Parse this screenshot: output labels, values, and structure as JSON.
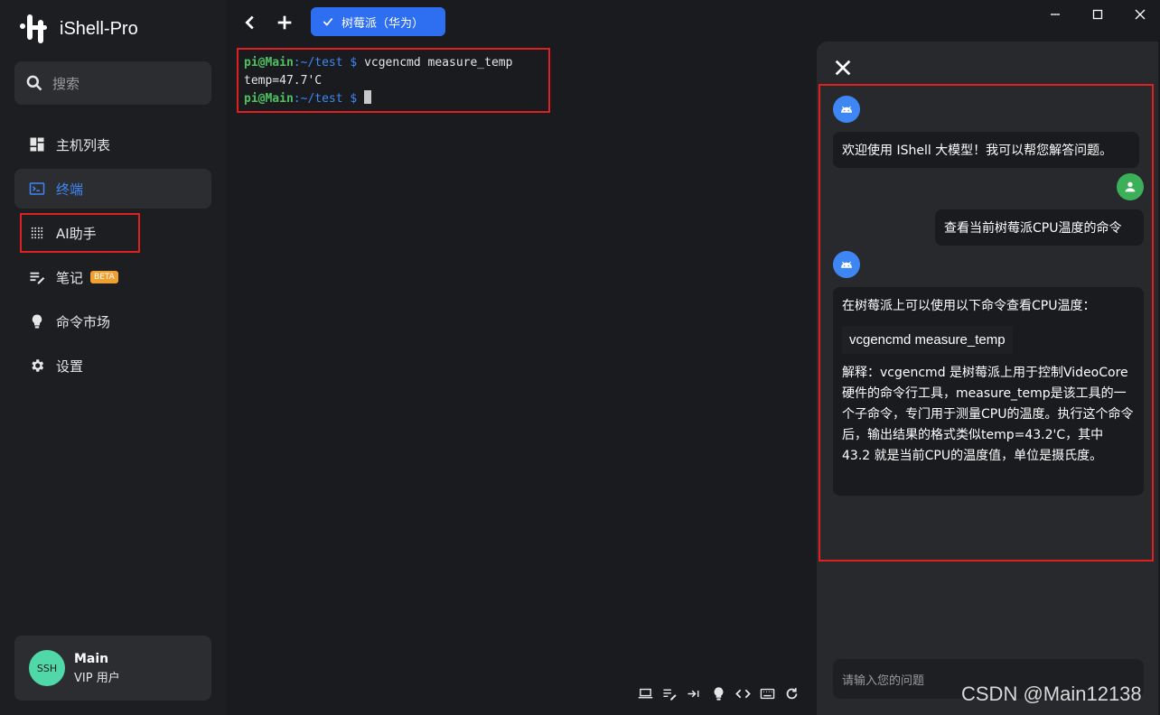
{
  "app": {
    "name": "iShell-Pro"
  },
  "search": {
    "placeholder": "搜索"
  },
  "nav": {
    "hosts": "主机列表",
    "terminal": "终端",
    "ai": "AI助手",
    "notes": "笔记",
    "notes_badge": "BETA",
    "market": "命令市场",
    "settings": "设置"
  },
  "profile": {
    "avatar_text": "SSH",
    "name": "Main",
    "role": "VIP 用户"
  },
  "tab": {
    "label": "树莓派（华为）"
  },
  "terminal": {
    "lines": [
      {
        "user": "pi@Main",
        "path": ":~/test $",
        "cmd": " vcgencmd measure_temp"
      },
      {
        "output": "temp=47.7'C"
      },
      {
        "user": "pi@Main",
        "path": ":~/test $",
        "cmd": " "
      }
    ]
  },
  "ai": {
    "welcome": "欢迎使用 IShell 大模型！我可以帮您解答问题。",
    "question": "查看当前树莓派CPU温度的命令",
    "answer_intro": "在树莓派上可以使用以下命令查看CPU温度：",
    "answer_code": "vcgencmd measure_temp",
    "answer_detail": "解释：vcgencmd 是树莓派上用于控制VideoCore硬件的命令行工具，measure_temp是该工具的一个子命令，专门用于测量CPU的温度。执行这个命令后，输出结果的格式类似temp=43.2'C，其中 43.2 就是当前CPU的温度值，单位是摄氏度。",
    "input_placeholder": "请输入您的问题"
  },
  "watermark": "CSDN @Main12138",
  "colors": {
    "accent": "#3f86f5",
    "highlight": "#e02020",
    "bot": "#3f86f5",
    "user": "#3cb058"
  }
}
